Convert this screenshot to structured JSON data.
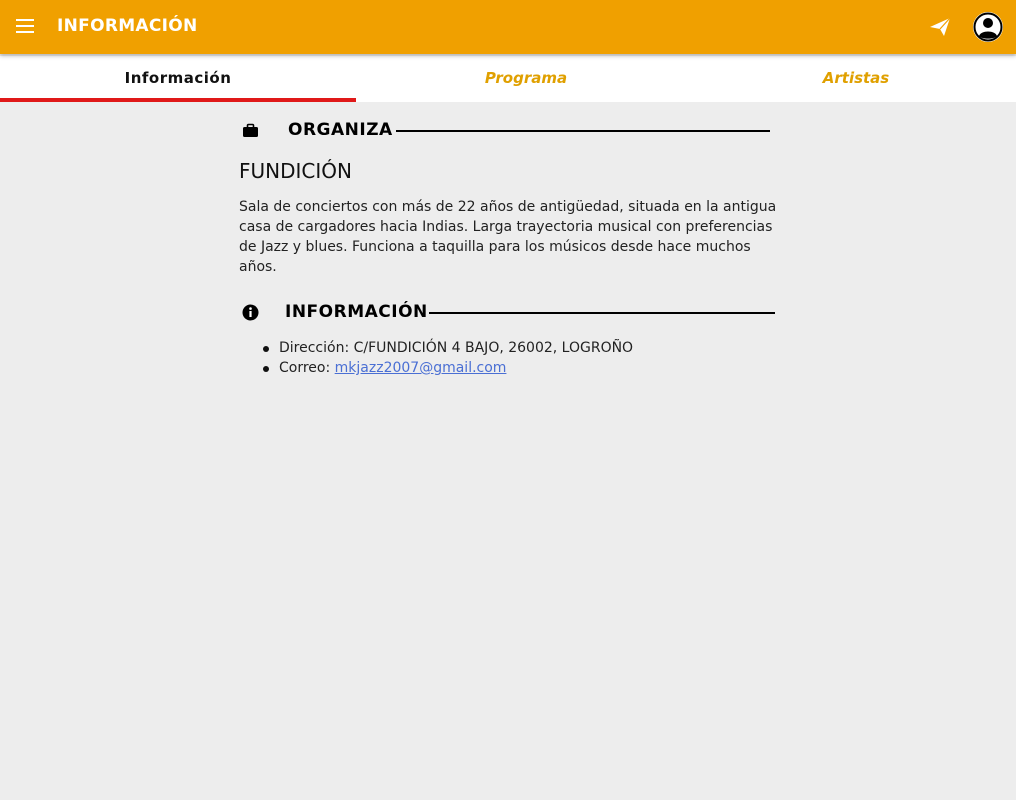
{
  "appbar": {
    "title": "INFORMACIÓN",
    "background": "#f0a000",
    "icons": [
      "menu-icon",
      "send-icon",
      "account-icon"
    ]
  },
  "tabs": [
    {
      "label": "Información",
      "active": true
    },
    {
      "label": "Programa",
      "active": false
    },
    {
      "label": "Artistas",
      "active": false
    }
  ],
  "organiza": {
    "heading": "ORGANIZA",
    "icon": "briefcase-icon",
    "name": "FUNDICIÓN",
    "description": "Sala de conciertos con más de 22 años de antigüedad, situada en la antigua casa de cargadores hacia Indias. Larga trayectoria musical con preferencias de Jazz y blues. Funciona a taquilla para los músicos desde hace muchos años."
  },
  "informacion": {
    "heading": "INFORMACIÓN",
    "icon": "info-icon",
    "address_label": "Dirección: ",
    "address": "C/FUNDICIÓN 4 BAJO, 26002, LOGROÑO",
    "email_label": "Correo: ",
    "email": "mkjazz2007@gmail.com"
  },
  "colors": {
    "accent": "#f0a000",
    "tab_indicator": "#e01919",
    "link": "#4a6fd4"
  }
}
